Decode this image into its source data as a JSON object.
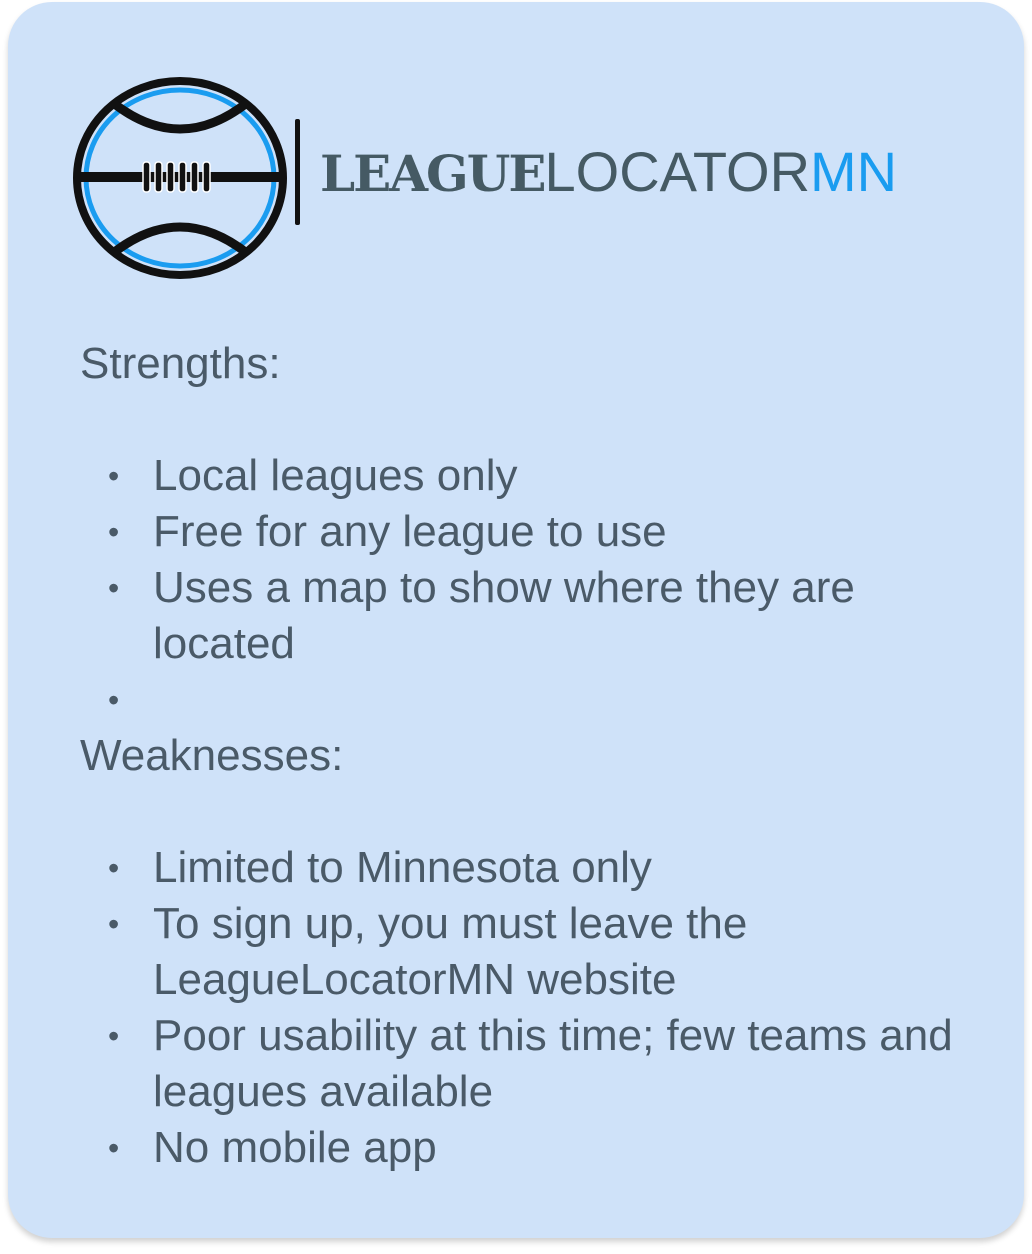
{
  "logo": {
    "word_bold": "LEAGUE",
    "word_light": "LOCATOR",
    "word_accent": "MN",
    "colors": {
      "dark": "#455a64",
      "accent": "#1a9cf0",
      "ring": "#111111"
    }
  },
  "strengths": {
    "heading": "Strengths:",
    "items": [
      "Local leagues only",
      "Free for any league to use",
      "Uses a map to show where they are located",
      ""
    ]
  },
  "weaknesses": {
    "heading": "Weaknesses:",
    "items": [
      "Limited to Minnesota only",
      "To sign up, you must leave the LeagueLocatorMN website",
      "Poor usability at this time; few teams and leagues available",
      "No mobile app"
    ]
  },
  "colors": {
    "card_bg": "#cfe2f9",
    "text": "#4a5a68"
  }
}
